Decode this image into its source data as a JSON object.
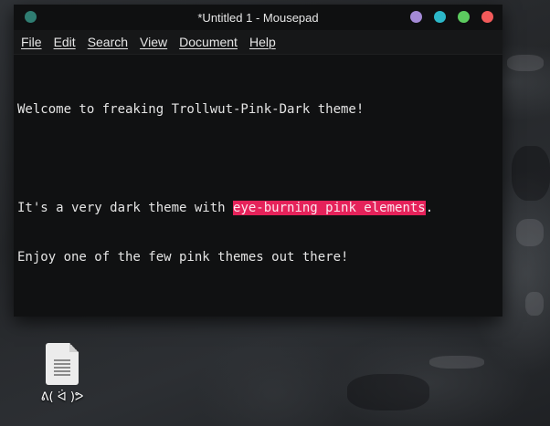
{
  "window": {
    "title": "*Untitled 1 - Mousepad",
    "buttons": [
      {
        "name": "minimize",
        "color": "#a48ad6"
      },
      {
        "name": "maximize",
        "color": "#2cb8c9"
      },
      {
        "name": "restore",
        "color": "#5ccb5f"
      },
      {
        "name": "close",
        "color": "#f25a5a"
      }
    ]
  },
  "menu": {
    "items": [
      "File",
      "Edit",
      "Search",
      "View",
      "Document",
      "Help"
    ]
  },
  "editor": {
    "line1": "Welcome to freaking Trollwut-Pink-Dark theme!",
    "line2_prefix": "It's a very dark theme with ",
    "line2_selected": "eye-burning pink elements",
    "line2_suffix": ".",
    "line3": "Enjoy one of the few pink themes out there!",
    "selection_color": "#e5225a"
  },
  "desktop": {
    "icon_label": "ᕕ( ᐛ )ᕗ"
  }
}
